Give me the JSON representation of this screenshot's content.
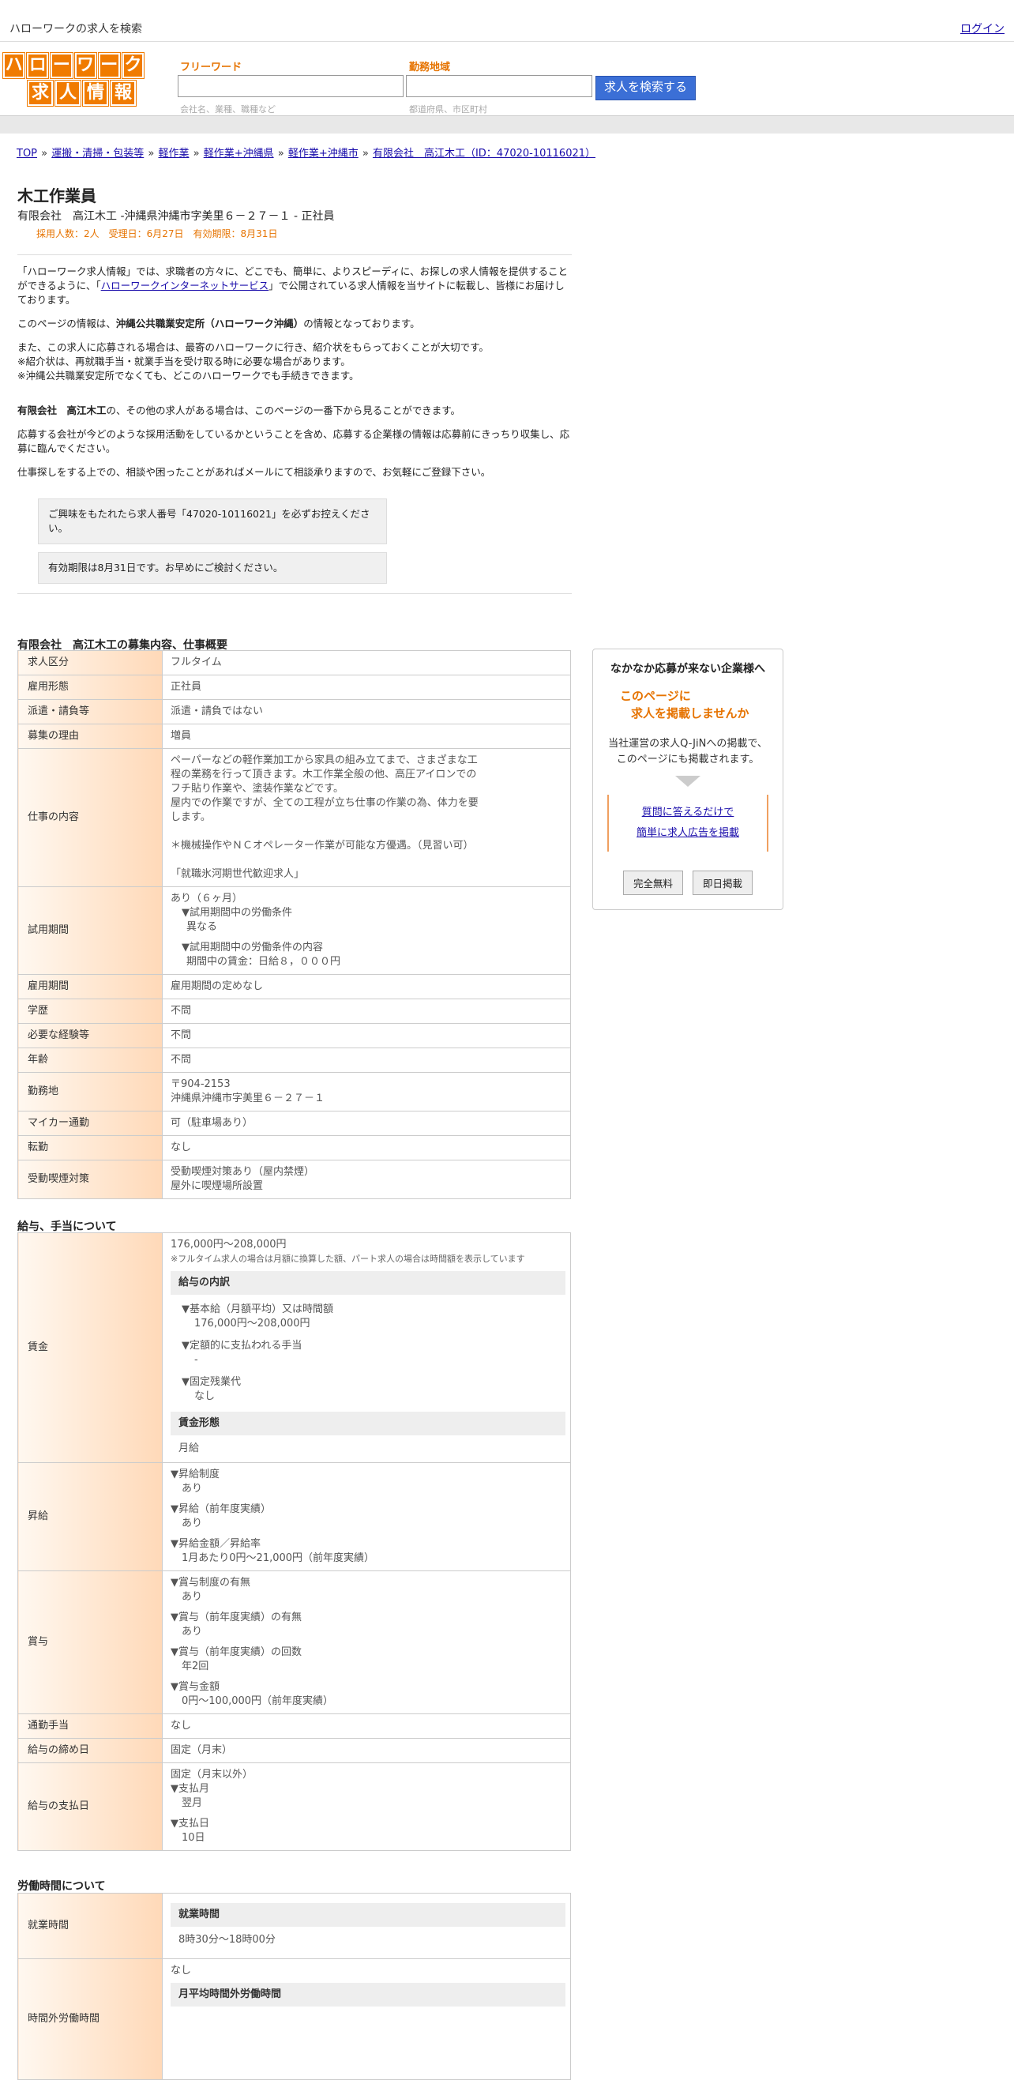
{
  "topbar": {
    "site_title": "ハローワークの求人を検索",
    "login": "ログイン"
  },
  "header": {
    "logo_row1": [
      "ハ",
      "ロ",
      "ー",
      "ワ",
      "ー",
      "ク"
    ],
    "logo_row2": [
      "求",
      "人",
      "情",
      "報"
    ],
    "freeword_label": "フリーワード",
    "freeword_hint": "会社名、業種、職種など",
    "area_label": "勤務地域",
    "area_hint": "都道府県、市区町村",
    "search_button": "求人を検索する"
  },
  "breadcrumb": [
    "TOP",
    "運搬・清掃・包装等",
    "軽作業",
    "軽作業+沖縄県",
    "軽作業+沖縄市",
    "有限会社　高江木工（ID：47020-10116021）"
  ],
  "job": {
    "title": "木工作業員",
    "subtitle": "有限会社　高江木工 -沖縄県沖縄市字美里６－２７－１ - 正社員",
    "meta": "採用人数：2人　受理日：6月27日　有効期限：8月31日"
  },
  "intro": {
    "p1_a": "「ハローワーク求人情報」では、求職者の方々に、どこでも、簡単に、よりスピーディに、お探しの求人情報を提供することができるように、「",
    "p1_link": "ハローワークインターネットサービス",
    "p1_b": "」で公開されている求人情報を当サイトに転載し、皆様にお届けしております。",
    "p2_a": "このページの情報は、",
    "p2_bold": "沖縄公共職業安定所（ハローワーク沖縄）",
    "p2_b": "の情報となっております。",
    "p3": "また、この求人に応募される場合は、最寄のハローワークに行き、紹介状をもらっておくことが大切です。",
    "p3b": "※紹介状は、再就職手当・就業手当を受け取る時に必要な場合があります。",
    "p3c": "※沖縄公共職業安定所でなくても、どこのハローワークでも手続きできます。",
    "p4_bold": "有限会社　高江木工",
    "p4_b": "の、その他の求人がある場合は、このページの一番下から見ることができます。",
    "p5": "応募する会社が今どのような採用活動をしているかということを含め、応募する企業様の情報は応募前にきっちり収集し、応募に臨んでください。",
    "p6": "仕事探しをする上での、相談や困ったことがあればメールにて相談承りますので、お気軽にご登録下さい。",
    "box1": "ご興味をもたれたら求人番号「47020-10116021」を必ずお控えください。",
    "box2": "有効期限は8月31日です。お早めにご検討ください。"
  },
  "overview": {
    "title": "有限会社　高江木工の募集内容、仕事概要",
    "rows": [
      {
        "k": "求人区分",
        "v": "フルタイム"
      },
      {
        "k": "雇用形態",
        "v": "正社員"
      },
      {
        "k": "派遣・請負等",
        "v": "派遣・請負ではない"
      },
      {
        "k": "募集の理由",
        "v": "増員"
      }
    ],
    "work_k": "仕事の内容",
    "work_v1": "ペーパーなどの軽作業加工から家具の組み立てまで、さまざまな工程の業務を行って頂きます。木工作業全般の他、高圧アイロンでのフチ貼り作業や、塗装作業などです。",
    "work_v2": "屋内での作業ですが、全ての工程が立ち仕事の作業の為、体力を要します。",
    "work_v3": "＊機械操作やＮＣオペレーター作業が可能な方優遇。（見習い可）",
    "work_v4": "「就職氷河期世代歓迎求人」",
    "trial_k": "試用期間",
    "trial_v1": "あり（６ヶ月）",
    "trial_v2": "▼試用期間中の労働条件",
    "trial_v3": "異なる",
    "trial_v4": "▼試用期間中の労働条件の内容",
    "trial_v5": "期間中の賃金：日給８，０００円",
    "rows2": [
      {
        "k": "雇用期間",
        "v": "雇用期間の定めなし"
      },
      {
        "k": "学歴",
        "v": "不問"
      },
      {
        "k": "必要な経験等",
        "v": "不問"
      },
      {
        "k": "年齢",
        "v": "不問"
      }
    ],
    "loc_k": "勤務地",
    "loc_v1": "〒904-2153",
    "loc_v2": "沖縄県沖縄市字美里６－２７－１",
    "car_k": "マイカー通勤",
    "car_v": "可（駐車場あり）",
    "transfer_k": "転勤",
    "transfer_v": "なし",
    "smoke_k": "受動喫煙対策",
    "smoke_v1": "受動喫煙対策あり（屋内禁煙）",
    "smoke_v2": "屋外に喫煙場所設置"
  },
  "salary": {
    "title": "給与、手当について",
    "wage_k": "賃金",
    "wage_v": "176,000円〜208,000円",
    "wage_note": "※フルタイム求人の場合は月額に換算した額、パート求人の場合は時間額を表示しています",
    "breakdown_head": "給与の内訳",
    "b1": "▼基本給（月額平均）又は時間額",
    "b1v": "176,000円〜208,000円",
    "b2": "▼定額的に支払われる手当",
    "b2v": "-",
    "b3": "▼固定残業代",
    "b3v": "なし",
    "form_head": "賃金形態",
    "form_v": "月給",
    "raise_k": "昇給",
    "r1": "▼昇給制度",
    "r1v": "あり",
    "r2": "▼昇給（前年度実績）",
    "r2v": "あり",
    "r3": "▼昇給金額／昇給率",
    "r3v": "1月あたり0円〜21,000円（前年度実績）",
    "bonus_k": "賞与",
    "s1": "▼賞与制度の有無",
    "s1v": "あり",
    "s2": "▼賞与（前年度実績）の有無",
    "s2v": "あり",
    "s3": "▼賞与（前年度実績）の回数",
    "s3v": "年2回",
    "s4": "▼賞与金額",
    "s4v": "0円〜100,000円（前年度実績）",
    "commute_k": "通勤手当",
    "commute_v": "なし",
    "close_k": "給与の締め日",
    "close_v": "固定（月末）",
    "pay_k": "給与の支払日",
    "p1": "固定（月末以外）",
    "p2": "▼支払月",
    "p2v": "翌月",
    "p3": "▼支払日",
    "p3v": "10日"
  },
  "hours": {
    "title": "労働時間について",
    "work_k": "就業時間",
    "work_head": "就業時間",
    "work_v": "8時30分〜18時00分",
    "ot_k": "時間外労働時間",
    "ot_v": "なし",
    "ot_head": "月平均時間外労働時間"
  },
  "side": {
    "title": "なかなか応募が来ない企業様へ",
    "catch1": "このページに",
    "catch2": "求人を掲載しませんか",
    "desc1": "当社運営の求人Q-JiNへの掲載で、",
    "desc2": "このページにも掲載されます。",
    "link1": "質問に答えるだけで",
    "link2": "簡単に求人広告を掲載",
    "btn1": "完全無料",
    "btn2": "即日掲載"
  }
}
